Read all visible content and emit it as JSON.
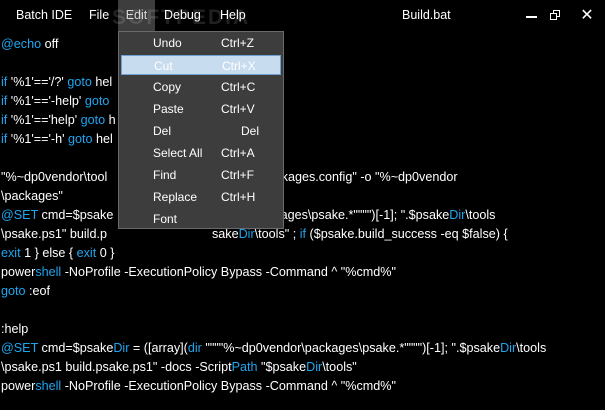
{
  "titlebar": {
    "app_title": "Batch IDE",
    "menus": [
      "File",
      "Edit",
      "Debug",
      "Help"
    ],
    "doc_title": "Build.bat",
    "watermark": "SOFTPEDIA"
  },
  "window_controls": {
    "minimize_icon": "minimize-icon",
    "maximize_icon": "restore-icon",
    "close_icon": "close-icon",
    "close_glyph": "✕"
  },
  "editor": {
    "lines": [
      [
        [
          "@echo",
          "kw"
        ],
        [
          " off",
          ""
        ]
      ],
      [],
      [
        [
          "if ",
          "kw"
        ],
        [
          "'%1'=='/?' ",
          ""
        ],
        [
          "goto",
          "kw"
        ],
        [
          " hel",
          ""
        ]
      ],
      [
        [
          "if ",
          "kw"
        ],
        [
          "'%1'=='-help' ",
          ""
        ],
        [
          "goto",
          "kw"
        ]
      ],
      [
        [
          "if ",
          "kw"
        ],
        [
          "'%1'=='help' ",
          ""
        ],
        [
          "goto",
          "kw"
        ],
        [
          " h",
          ""
        ]
      ],
      [
        [
          "if ",
          "kw"
        ],
        [
          "'%1'=='-h' ",
          ""
        ],
        [
          "goto",
          "kw"
        ],
        [
          " hel",
          ""
        ]
      ],
      [],
      [
        [
          "\"%~dp0vendor\\tool",
          ""
        ],
        [
          "                              ",
          ""
        ],
        [
          "0vendor\\packages.config\" -o \"%~dp0vendor",
          ""
        ]
      ],
      [
        [
          "\\packages\"",
          ""
        ]
      ],
      [
        [
          "@SET",
          "kw"
        ],
        [
          " cmd=$psake",
          ""
        ],
        [
          "                              ",
          ""
        ],
        [
          "endor\\packages\\psake.*\"\"\"\")[-1]; \".$psake",
          ""
        ],
        [
          "Dir",
          "kw"
        ],
        [
          "\\tools",
          ""
        ]
      ],
      [
        [
          "\\psake.ps1\" build.p",
          ""
        ],
        [
          "                              ",
          ""
        ],
        [
          "sake",
          ""
        ],
        [
          "Dir",
          "kw"
        ],
        [
          "\\tools\" ; ",
          ""
        ],
        [
          "if",
          "kw"
        ],
        [
          " ($psake.build_success -eq $false) {",
          ""
        ]
      ],
      [
        [
          "exit",
          "kw"
        ],
        [
          " 1 } else { ",
          ""
        ],
        [
          "exit",
          "kw"
        ],
        [
          " 0 }",
          ""
        ]
      ],
      [
        [
          "power",
          ""
        ],
        [
          "shell",
          "kw"
        ],
        [
          " -NoProfile -ExecutionPolicy Bypass -Command ^ \"%cmd%\"",
          ""
        ]
      ],
      [
        [
          "goto",
          "kw"
        ],
        [
          " :eof",
          ""
        ]
      ],
      [],
      [
        [
          ":help",
          ""
        ]
      ],
      [
        [
          "@SET",
          "kw"
        ],
        [
          " cmd=$psake",
          ""
        ],
        [
          "Dir",
          "kw"
        ],
        [
          " = ([array](",
          ""
        ],
        [
          "dir",
          "kw"
        ],
        [
          " \"\"\"\"%~dp0vendor\\packages\\psake.*\"\"\"\")[-1]; \".$psake",
          ""
        ],
        [
          "Dir",
          "kw"
        ],
        [
          "\\tools",
          ""
        ]
      ],
      [
        [
          "\\psake.ps1 build.psake.ps1\" -docs -Script",
          ""
        ],
        [
          "Path",
          "kw"
        ],
        [
          " \"$psake",
          ""
        ],
        [
          "Dir",
          "kw"
        ],
        [
          "\\tools\"",
          ""
        ]
      ],
      [
        [
          "power",
          ""
        ],
        [
          "shell",
          "kw"
        ],
        [
          " -NoProfile -ExecutionPolicy Bypass -Command ^ \"%cmd%\"",
          ""
        ]
      ]
    ]
  },
  "edit_menu": {
    "items": [
      {
        "label": "Undo",
        "shortcut": "Ctrl+Z"
      },
      {
        "label": "Cut",
        "shortcut": "Ctrl+X",
        "highlighted": true
      },
      {
        "label": "Copy",
        "shortcut": "Ctrl+C"
      },
      {
        "label": "Paste",
        "shortcut": "Ctrl+V"
      },
      {
        "label": "Del",
        "shortcut": "Del"
      },
      {
        "label": "Select All",
        "shortcut": "Ctrl+A"
      },
      {
        "label": "Find",
        "shortcut": "Ctrl+F"
      },
      {
        "label": "Replace",
        "shortcut": "Ctrl+H"
      },
      {
        "label": "Font",
        "shortcut": ""
      }
    ]
  },
  "colors": {
    "background": "#000000",
    "keyword": "#1fa6f0",
    "menu_bg": "#3d3d3d",
    "highlight": "#c8dcf0"
  }
}
